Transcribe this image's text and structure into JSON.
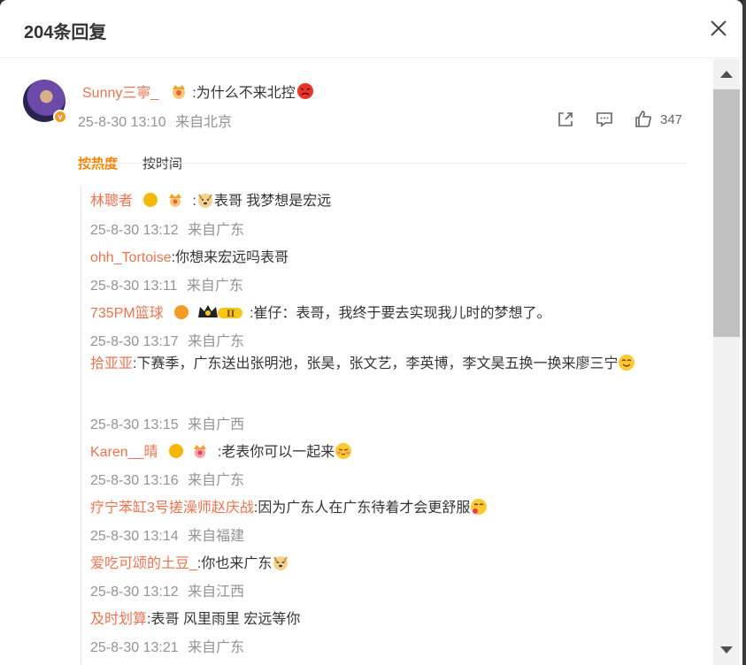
{
  "header": {
    "title": "204条回复"
  },
  "main_comment": {
    "username": "Sunny三寧_",
    "text": ":为什么不来北控",
    "time": "25-8-30 13:10",
    "location": "来自北京",
    "likes": "347",
    "icons": {
      "share": "share-icon",
      "comment": "comment-icon",
      "like": "thumbs-up-icon"
    }
  },
  "sort": {
    "hot": "按热度",
    "time": "按时间"
  },
  "replies": [
    {
      "name": "林聰者",
      "text": ":表哥 我梦想是宏远",
      "time": "25-8-30 13:12",
      "location": "来自广东"
    },
    {
      "name": "ohh_Tortoise",
      "text": ":你想来宏远吗表哥",
      "time": "25-8-30 13:11",
      "location": "来自广东"
    },
    {
      "name": "735PM篮球",
      "text": ":崔仔：表哥，我终于要去实现我儿时的梦想了。",
      "time": "25-8-30 13:17",
      "location": "来自广东"
    },
    {
      "name": "拾亚亚",
      "text": ":下赛季，广东送出张明池，张昊，张文艺，李英博，李文昊五换一换来廖三宁",
      "time": "25-8-30 13:15",
      "location": "来自广西"
    },
    {
      "name": "Karen__晴",
      "text": ":老表你可以一起来",
      "time": "25-8-30 13:16",
      "location": "来自广东"
    },
    {
      "name": "疗宁苯缸3号搓澡师赵庆战",
      "text": ":因为广东人在广东待着才会更舒服",
      "time": "25-8-30 13:14",
      "location": "来自福建"
    },
    {
      "name": "爱吃可颂的土豆_",
      "text": ":你也来广东",
      "time": "25-8-30 13:12",
      "location": "来自江西"
    },
    {
      "name": "及时划算",
      "text": ":表哥  风里雨里 宏远等你",
      "time": "25-8-30 13:21",
      "location": "来自广东"
    }
  ],
  "colors": {
    "accent": "#ff8200",
    "username": "#eb7350",
    "meta": "#939393"
  }
}
